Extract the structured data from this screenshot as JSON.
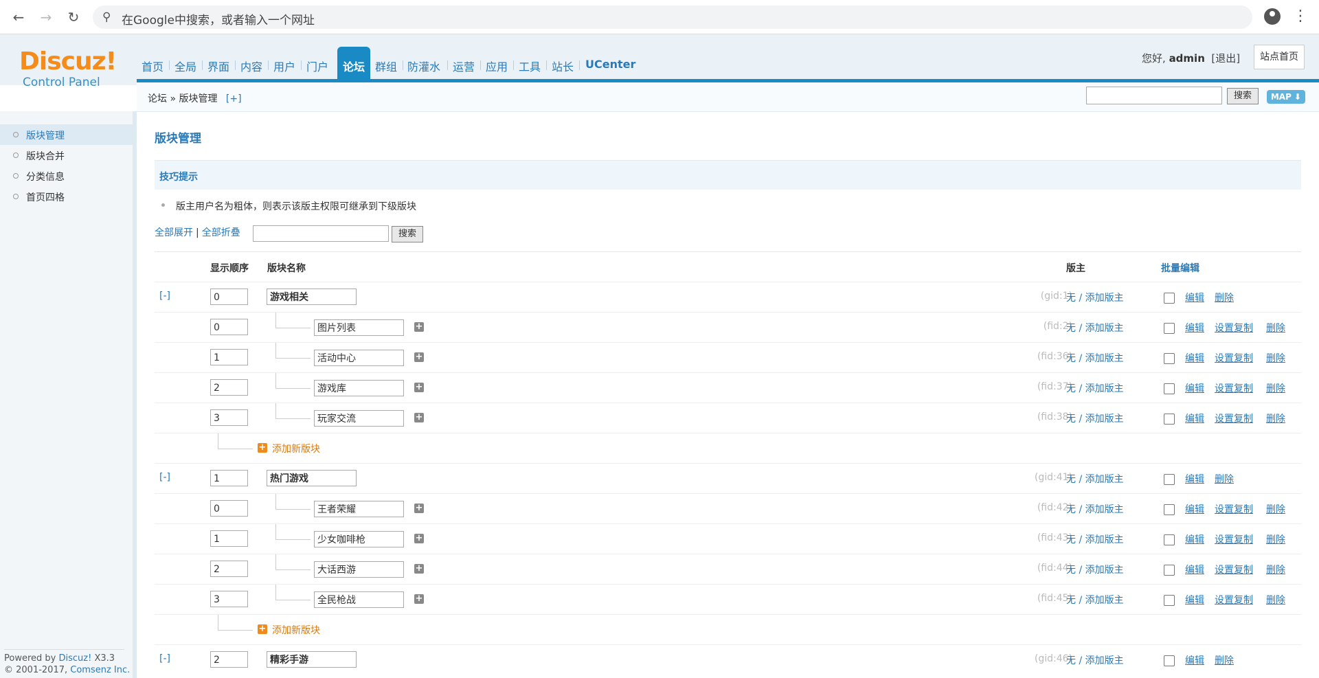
{
  "browser": {
    "omnibox_placeholder": "在Google中搜索，或者输入一个网址"
  },
  "header": {
    "logo_brand": "Discuz!",
    "logo_sub": "Control Panel",
    "nav": [
      "首页",
      "全局",
      "界面",
      "内容",
      "用户",
      "门户",
      "论坛",
      "群组",
      "防灌水",
      "运营",
      "应用",
      "工具",
      "站长",
      "UCenter"
    ],
    "active_nav": "论坛",
    "greeting": "您好,",
    "username": "admin",
    "logout": "[退出]",
    "site_home": "站点首页"
  },
  "crumb": {
    "path": "论坛 » 版块管理",
    "plus": "[+]",
    "search_btn": "搜索",
    "map_btn": "MAP ⬇"
  },
  "sidebar": {
    "items": [
      {
        "label": "版块管理",
        "active": true
      },
      {
        "label": "版块合并",
        "active": false
      },
      {
        "label": "分类信息",
        "active": false
      },
      {
        "label": "首页四格",
        "active": false
      }
    ],
    "powered_prefix": "Powered by ",
    "powered_link": "Discuz!",
    "powered_ver": " X3.3",
    "copyright_prefix": "© 2001-2017, ",
    "copyright_link": "Comsenz Inc."
  },
  "main": {
    "title": "版块管理",
    "tips_title": "技巧提示",
    "tip": "版主用户名为粗体，则表示该版主权限可继承到下级版块",
    "expand_all": "全部展开",
    "collapse_all": "全部折叠",
    "search_btn": "搜索",
    "columns": {
      "order": "显示顺序",
      "name": "版块名称",
      "moderator": "版主",
      "batch": "批量编辑"
    },
    "toggle": "[-]",
    "mod_none": "无",
    "mod_add": "添加版主",
    "mod_sep": " / ",
    "act_edit": "编辑",
    "act_copy": "设置复制",
    "act_delete": "删除",
    "add_forum": "添加新版块",
    "groups": [
      {
        "order": "0",
        "name": "游戏相关",
        "id": "(gid:1)",
        "forums": [
          {
            "order": "0",
            "name": "图片列表",
            "id": "(fid:2)"
          },
          {
            "order": "1",
            "name": "活动中心",
            "id": "(fid:36)"
          },
          {
            "order": "2",
            "name": "游戏库",
            "id": "(fid:37)"
          },
          {
            "order": "3",
            "name": "玩家交流",
            "id": "(fid:38)"
          }
        ]
      },
      {
        "order": "1",
        "name": "热门游戏",
        "id": "(gid:41)",
        "forums": [
          {
            "order": "0",
            "name": "王者荣耀",
            "id": "(fid:42)"
          },
          {
            "order": "1",
            "name": "少女咖啡枪",
            "id": "(fid:43)"
          },
          {
            "order": "2",
            "name": "大话西游",
            "id": "(fid:44)"
          },
          {
            "order": "3",
            "name": "全民枪战",
            "id": "(fid:45)"
          }
        ]
      },
      {
        "order": "2",
        "name": "精彩手游",
        "id": "(gid:46)",
        "forums": []
      }
    ]
  }
}
